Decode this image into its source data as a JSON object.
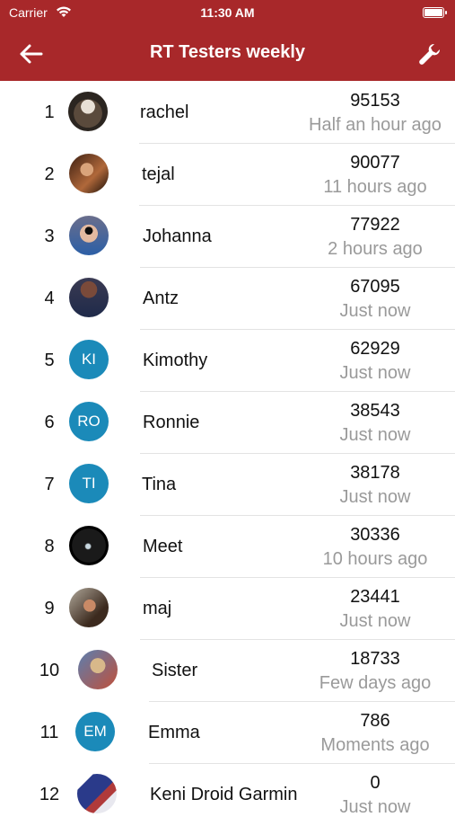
{
  "status_bar": {
    "carrier": "Carrier",
    "time": "11:30 AM"
  },
  "nav": {
    "title": "RT Testers weekly",
    "back_icon": "arrow-left-icon",
    "settings_icon": "wrench-icon"
  },
  "colors": {
    "brand": "#a8282a",
    "initials_avatar": "#1b8ab9",
    "secondary_text": "#9a9a9a"
  },
  "leaderboard": [
    {
      "rank": "1",
      "name": "rachel",
      "score": "95153",
      "time": "Half an hour ago",
      "avatar": "photo"
    },
    {
      "rank": "2",
      "name": "tejal",
      "score": "90077",
      "time": "11 hours ago",
      "avatar": "photo"
    },
    {
      "rank": "3",
      "name": "Johanna",
      "score": "77922",
      "time": "2 hours ago",
      "avatar": "photo"
    },
    {
      "rank": "4",
      "name": "Antz",
      "score": "67095",
      "time": "Just now",
      "avatar": "photo"
    },
    {
      "rank": "5",
      "name": "Kimothy",
      "score": "62929",
      "time": "Just now",
      "avatar": "initials",
      "initials": "KI"
    },
    {
      "rank": "6",
      "name": "Ronnie",
      "score": "38543",
      "time": "Just now",
      "avatar": "initials",
      "initials": "RO"
    },
    {
      "rank": "7",
      "name": "Tina",
      "score": "38178",
      "time": "Just now",
      "avatar": "initials",
      "initials": "TI"
    },
    {
      "rank": "8",
      "name": "Meet",
      "score": "30336",
      "time": "10 hours ago",
      "avatar": "photo"
    },
    {
      "rank": "9",
      "name": "maj",
      "score": "23441",
      "time": "Just now",
      "avatar": "photo"
    },
    {
      "rank": "10",
      "name": "Sister",
      "score": "18733",
      "time": "Few days ago",
      "avatar": "photo"
    },
    {
      "rank": "11",
      "name": "Emma",
      "score": "786",
      "time": "Moments ago",
      "avatar": "initials",
      "initials": "EM"
    },
    {
      "rank": "12",
      "name": "Keni Droid Garmin",
      "score": "0",
      "time": "Just now",
      "avatar": "photo"
    }
  ]
}
